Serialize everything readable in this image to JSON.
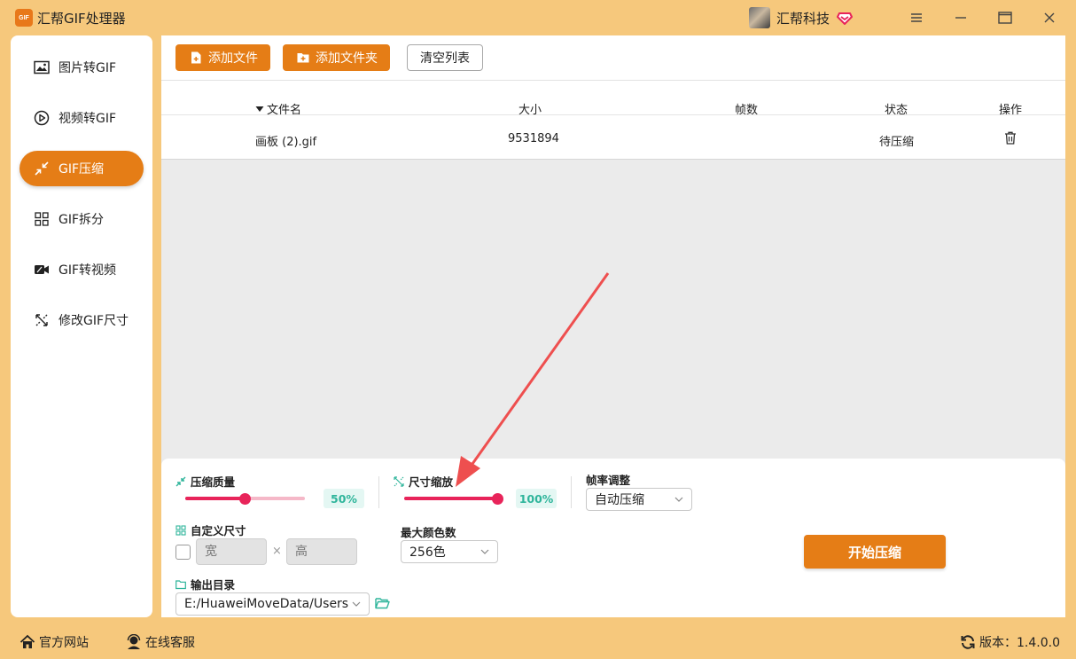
{
  "app": {
    "title": "汇帮GIF处理器",
    "logo_text": "GIF",
    "user_name": "汇帮科技"
  },
  "sidebar": {
    "items": [
      {
        "label": "图片转GIF",
        "icon": "image-icon",
        "active": false
      },
      {
        "label": "视频转GIF",
        "icon": "play-circle-icon",
        "active": false
      },
      {
        "label": "GIF压缩",
        "icon": "compress-icon",
        "active": true
      },
      {
        "label": "GIF拆分",
        "icon": "split-grid-icon",
        "active": false
      },
      {
        "label": "GIF转视频",
        "icon": "video-camera-icon",
        "active": false
      },
      {
        "label": "修改GIF尺寸",
        "icon": "resize-icon",
        "active": false
      }
    ]
  },
  "toolbar": {
    "add_file": "添加文件",
    "add_folder": "添加文件夹",
    "clear_list": "清空列表"
  },
  "table": {
    "headers": [
      "文件名",
      "大小",
      "帧数",
      "状态",
      "操作"
    ],
    "rows": [
      {
        "name": "画板 (2).gif",
        "size": "9531894",
        "frames": "",
        "status": "待压缩"
      }
    ]
  },
  "settings": {
    "quality": {
      "label": "压缩质量",
      "value_text": "50%",
      "value": 0.5
    },
    "scale": {
      "label": "尺寸缩放",
      "value_text": "100%",
      "value": 1.0
    },
    "framerate": {
      "label": "帧率调整",
      "selected": "自动压缩"
    },
    "custom_size": {
      "label": "自定义尺寸",
      "width_placeholder": "宽",
      "height_placeholder": "高",
      "times": "×"
    },
    "max_colors": {
      "label": "最大颜色数",
      "selected": "256色"
    },
    "output": {
      "label": "输出目录",
      "path": "E:/HuaweiMoveData/Users"
    },
    "start_button": "开始压缩"
  },
  "footer": {
    "website": "官方网站",
    "support": "在线客服",
    "version": "版本：1.4.0.0"
  },
  "colors": {
    "accent": "#e57d16",
    "title_bar": "#f6c87c",
    "slider": "#e8245a",
    "slider_light": "#f5b8c8",
    "badge_text": "#2fb59b",
    "annotation_arrow": "#ee4f4f"
  }
}
